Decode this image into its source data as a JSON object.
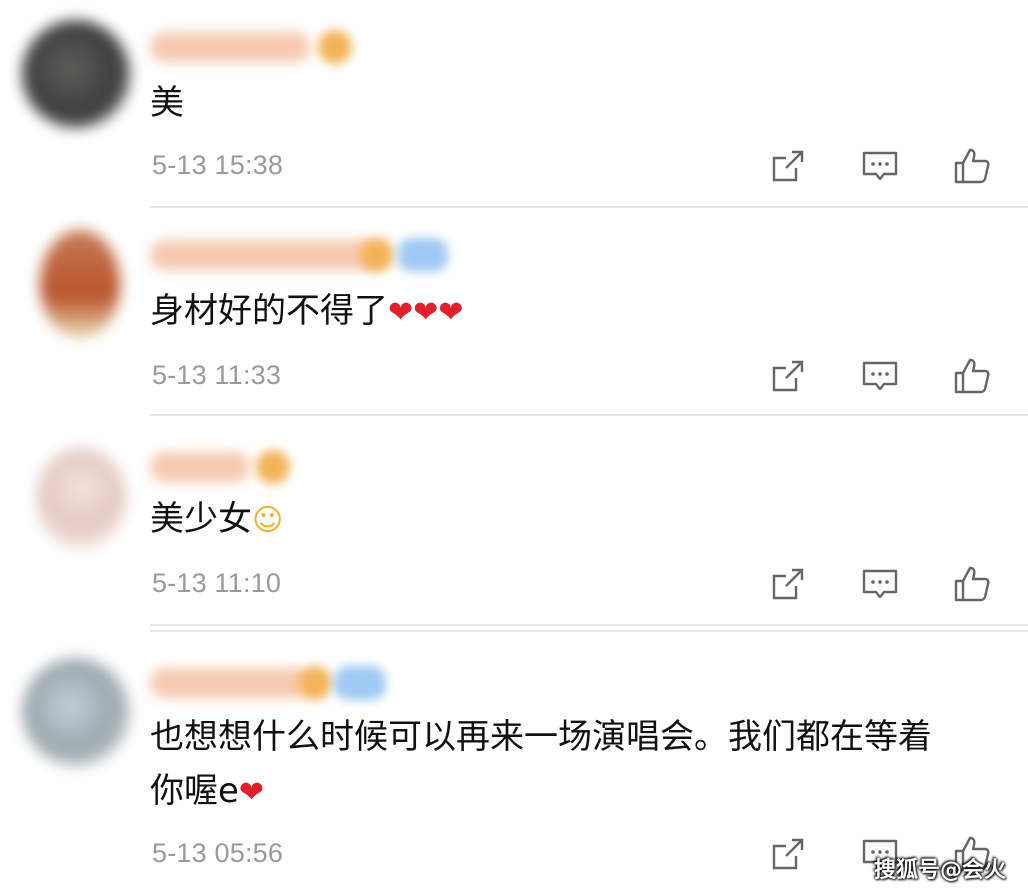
{
  "comments": [
    {
      "text": "美",
      "emoji": "",
      "time": "5-13 15:38"
    },
    {
      "text": "身材好的不得了",
      "emoji": "❤❤❤",
      "time": "5-13 11:33"
    },
    {
      "text": "美少女",
      "emoji": "☺",
      "time": "5-13 11:10"
    },
    {
      "text_line1": "也想想什么时候可以再来一场演唱会。我们都在等着",
      "text_line2": "你喔e",
      "emoji": "❤",
      "time": "5-13 05:56"
    }
  ],
  "icons": {
    "share": "share-icon",
    "reply": "comment-icon",
    "like": "thumbs-up-icon"
  },
  "colors": {
    "heart": "#e0202c",
    "timestamp": "#9a9a9a",
    "icon": "#666666",
    "divider": "#e6e6e6"
  },
  "watermark": "搜狐号@会火"
}
